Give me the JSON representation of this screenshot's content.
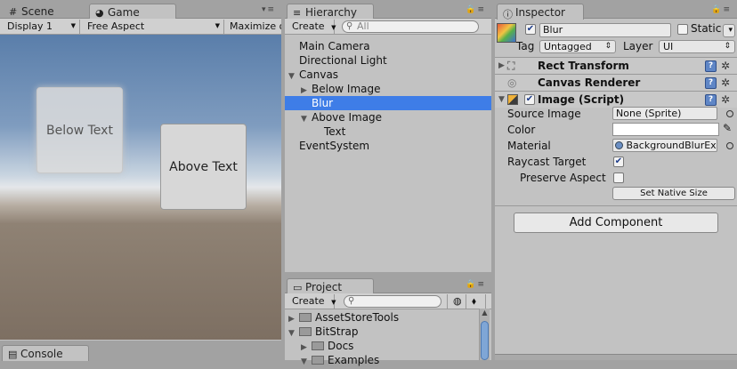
{
  "scene_game_panel": {
    "tabs": [
      {
        "label": "Scene"
      },
      {
        "label": "Game"
      }
    ],
    "toolbar": {
      "display": "Display 1",
      "aspect": "Free Aspect",
      "maximize": "Maximize on"
    },
    "boxes": {
      "below": "Below Text",
      "above": "Above Text"
    }
  },
  "console": {
    "tab": "Console"
  },
  "hierarchy": {
    "tab": "Hierarchy",
    "create": "Create",
    "search_placeholder": "All",
    "items": [
      {
        "label": "Main Camera"
      },
      {
        "label": "Directional Light"
      },
      {
        "label": "Canvas"
      },
      {
        "label": "Below Image"
      },
      {
        "label": "Blur"
      },
      {
        "label": "Above Image"
      },
      {
        "label": "Text"
      },
      {
        "label": "EventSystem"
      }
    ]
  },
  "project": {
    "tab": "Project",
    "create": "Create",
    "folders": [
      {
        "label": "AssetStoreTools"
      },
      {
        "label": "BitStrap"
      },
      {
        "label": "Docs"
      },
      {
        "label": "Examples"
      }
    ]
  },
  "inspector": {
    "tab": "Inspector",
    "object_name": "Blur",
    "static_label": "Static",
    "tag_label": "Tag",
    "tag_value": "Untagged",
    "layer_label": "Layer",
    "layer_value": "UI",
    "components": {
      "rect_transform": "Rect Transform",
      "canvas_renderer": "Canvas Renderer",
      "image_script": "Image (Script)"
    },
    "fields": {
      "source_image_label": "Source Image",
      "source_image_value": "None (Sprite)",
      "color_label": "Color",
      "material_label": "Material",
      "material_value": "BackgroundBlurEx",
      "raycast_label": "Raycast Target",
      "preserve_label": "Preserve Aspect",
      "set_native_size": "Set Native Size"
    },
    "add_component": "Add Component"
  },
  "colors": {
    "selection": "#3e7de7",
    "panel": "#c2c2c2"
  }
}
